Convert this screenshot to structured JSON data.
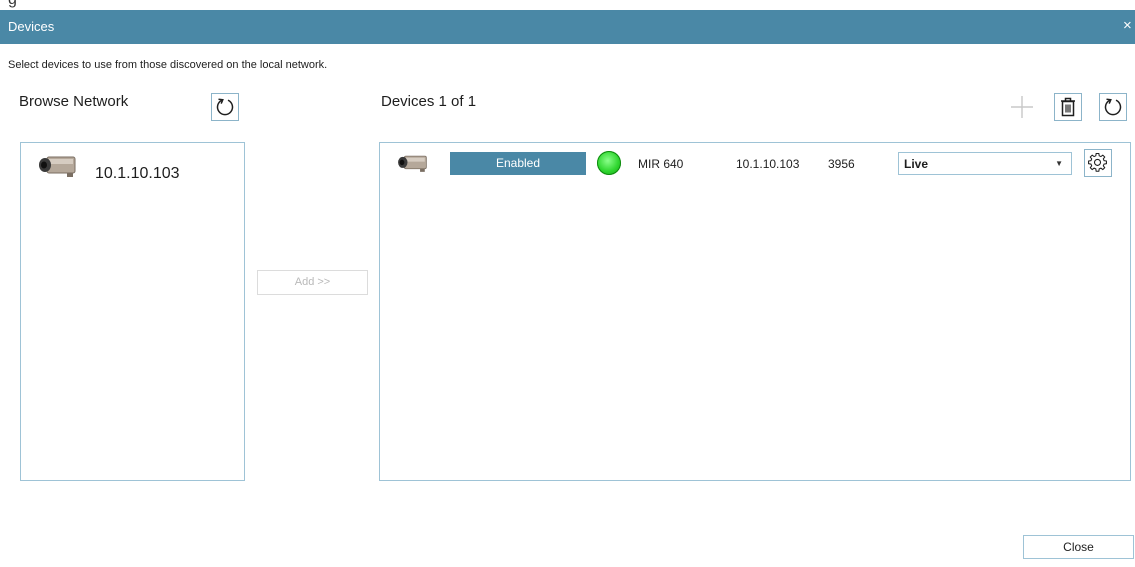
{
  "app": {
    "background_title_fragment": "g",
    "window_title": "Devices",
    "close_glyph": "×"
  },
  "instructions": "Select devices to use from those discovered on the local network.",
  "browse": {
    "heading": "Browse Network",
    "refresh_icon": "refresh-icon",
    "items": [
      {
        "ip": "10.1.10.103",
        "icon": "camera-icon"
      }
    ]
  },
  "add_button": {
    "label": "Add >>",
    "enabled": false
  },
  "devices": {
    "heading": "Devices 1 of 1",
    "toolbar": {
      "add_icon": "plus-icon",
      "delete_icon": "trash-icon",
      "refresh_icon": "refresh-icon"
    },
    "rows": [
      {
        "icon": "camera-icon",
        "state_label": "Enabled",
        "status_color": "#2fd62f",
        "model": "MIR 640",
        "ip": "10.1.10.103",
        "port": "3956",
        "mode": "Live",
        "settings_icon": "gear-icon"
      }
    ]
  },
  "close_button": {
    "label": "Close"
  },
  "colors": {
    "accent": "#4a88a6",
    "border": "#9ec3d6",
    "status_ok": "#2fd62f"
  }
}
